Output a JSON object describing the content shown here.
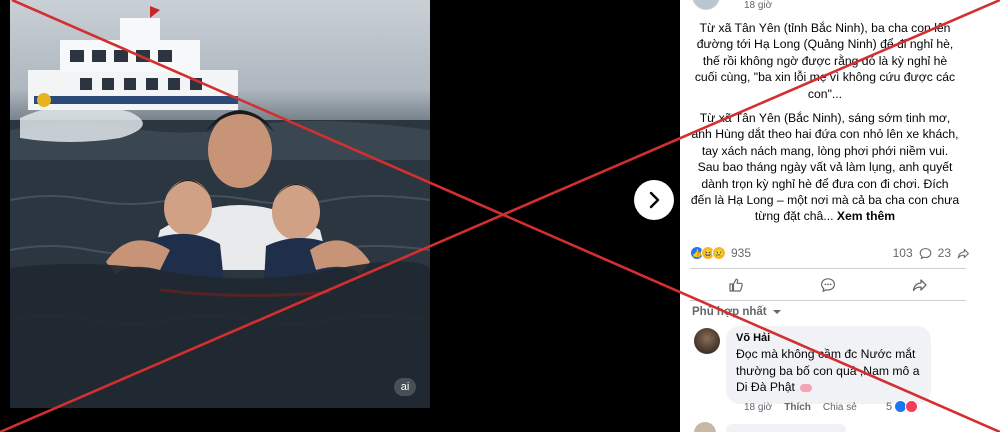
{
  "post": {
    "time": "18 giờ",
    "paragraph1": "Từ xã Tân Yên (tỉnh Bắc Ninh), ba cha con lên đường tới Hạ Long (Quảng Ninh) để đi nghỉ hè, thế rồi không ngờ được rằng đó là kỳ nghỉ hè cuối cùng, \"ba xin lỗi mẹ vì không cứu được các con\"...",
    "paragraph2": "Từ xã Tân Yên (Bắc Ninh), sáng sớm tinh mơ, anh Hùng dắt theo hai đứa con nhỏ lên xe khách, tay xách nách mang, lòng phơi phới niềm vui. Sau bao tháng ngày vất vả làm lụng, anh quyết dành trọn kỳ nghỉ hè để đưa con đi chơi. Đích đến là Hạ Long – một nơi mà cả ba cha con chưa từng đặt châ...",
    "see_more": "Xem thêm",
    "reaction_count": "935",
    "comment_count": "103",
    "share_count": "23"
  },
  "photo": {
    "badge": "ai"
  },
  "sort_label": "Phù hợp nhất",
  "comment": {
    "author": "Võ Hải",
    "text": "Đọc mà không cầm đc Nước mắt thường ba bố con quá ,Nam mô a Di Đà Phật",
    "time": "18 giờ",
    "like": "Thích",
    "share": "Chia sẻ",
    "reaction_count": "5"
  },
  "colors": {
    "cross": "#d32f2f",
    "accent": "#1877f2"
  }
}
